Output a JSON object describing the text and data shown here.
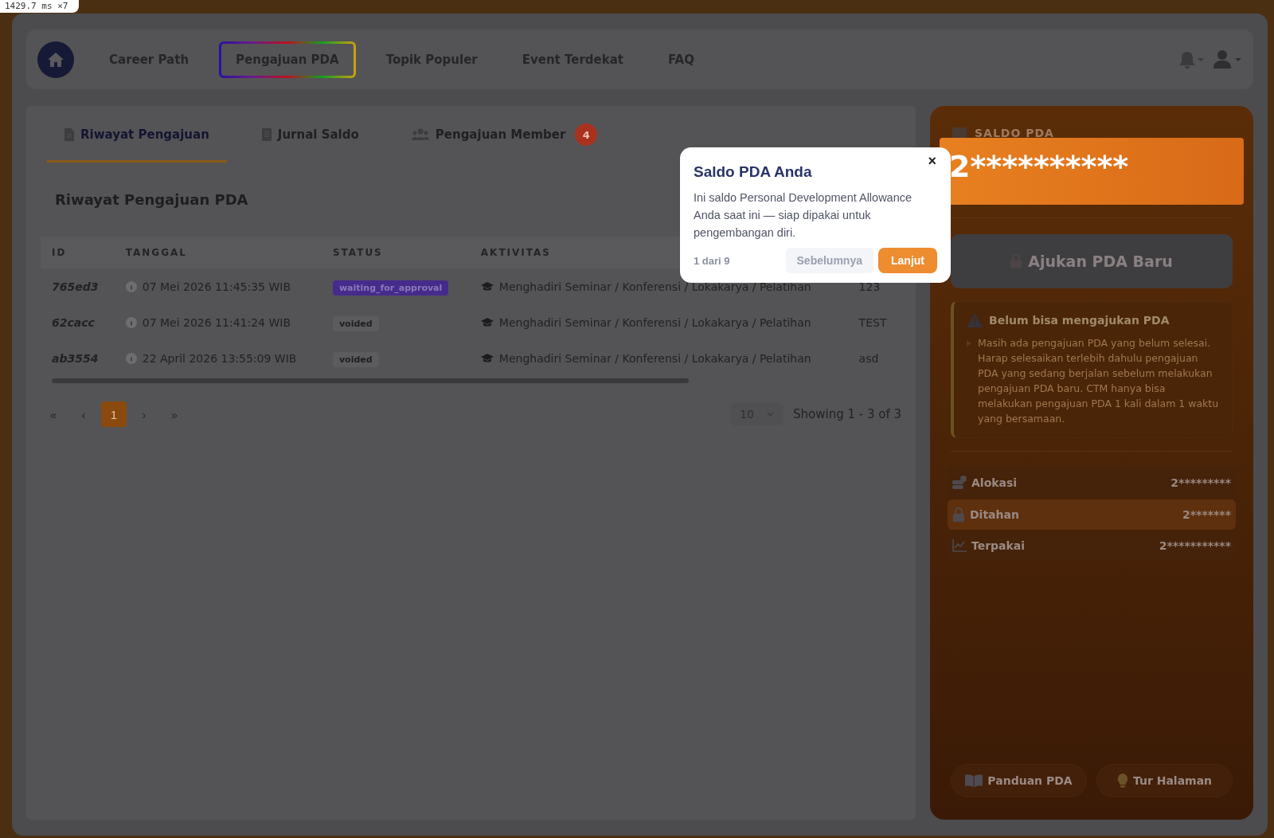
{
  "perf_badge": "1429.7 ms ×7",
  "nav": {
    "items": [
      {
        "label": "Career Path",
        "selected": false
      },
      {
        "label": "Pengajuan PDA",
        "selected": true
      },
      {
        "label": "Topik Populer",
        "selected": false
      },
      {
        "label": "Event Terdekat",
        "selected": false
      },
      {
        "label": "FAQ",
        "selected": false
      }
    ]
  },
  "tabs": [
    {
      "label": "Riwayat Pengajuan",
      "selected": true
    },
    {
      "label": "Jurnal Saldo",
      "selected": false
    },
    {
      "label": "Pengajuan Member",
      "selected": false,
      "badge": "4"
    }
  ],
  "section_title": "Riwayat Pengajuan PDA",
  "table": {
    "columns": [
      "ID",
      "TANGGAL",
      "STATUS",
      "AKTIVITAS"
    ],
    "rows": [
      {
        "id": "765ed3",
        "date": "07 Mei 2026 11:45:35 WIB",
        "status": "waiting_for_approval",
        "kind": "pending",
        "activity": "Menghadiri Seminar / Konferensi / Lokakarya / Pelatihan",
        "column_5": "123"
      },
      {
        "id": "62cacc",
        "date": "07 Mei 2026 11:41:24 WIB",
        "status": "voided",
        "kind": "voided",
        "activity": "Menghadiri Seminar / Konferensi / Lokakarya / Pelatihan",
        "column_5": "TEST"
      },
      {
        "id": "ab3554",
        "date": "22 April 2026 13:55:09 WIB",
        "status": "voided",
        "kind": "voided",
        "activity": "Menghadiri Seminar / Konferensi / Lokakarya / Pelatihan",
        "column_5": "asd"
      }
    ]
  },
  "pagination": {
    "first": "«",
    "prev": "‹",
    "pages": [
      {
        "label": "1",
        "selected": true
      }
    ],
    "next": "›",
    "last": "»",
    "page_size": "10",
    "summary": "Showing 1 - 3 of 3"
  },
  "tooltip": {
    "title": "Saldo PDA Anda",
    "body": "Ini saldo Personal Development Allowance Anda saat ini — siap dipakai untuk pengembangan diri.",
    "step": "1 dari 9",
    "prev": "Sebelumnya",
    "next": "Lanjut",
    "close": "×"
  },
  "saldo": {
    "label": "SALDO PDA",
    "amount": "2**********",
    "submit_button": "Ajukan PDA Baru",
    "submit_disabled": true,
    "warning": {
      "title": "Belum bisa mengajukan PDA",
      "items": [
        "Masih ada pengajuan PDA yang belum selesai. Harap selesaikan terlebih dahulu pengajuan PDA yang sedang berjalan sebelum melakukan pengajuan PDA baru. CTM hanya bisa melakukan pengajuan PDA 1 kali dalam 1 waktu yang bersamaan."
      ]
    },
    "stats": [
      {
        "label": "Alokasi",
        "value": "2*********",
        "highlighted": false
      },
      {
        "label": "Ditahan",
        "value": "2*******",
        "highlighted": true
      },
      {
        "label": "Terpakai",
        "value": "2***********",
        "highlighted": false
      }
    ],
    "footer_buttons": [
      {
        "label": "Panduan PDA"
      },
      {
        "label": "Tur Halaman"
      }
    ]
  }
}
